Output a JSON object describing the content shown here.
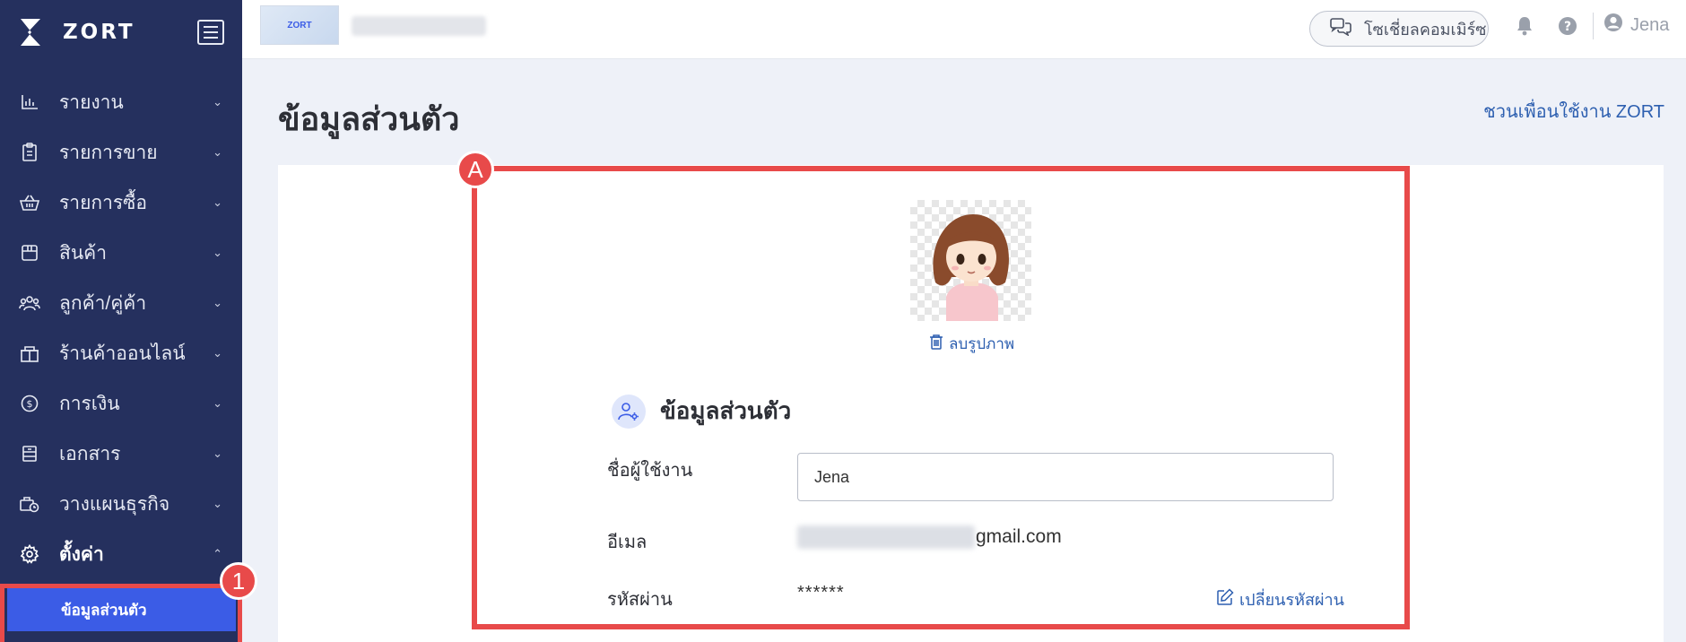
{
  "brand": {
    "name": "ZORT"
  },
  "sidebar": {
    "items": [
      {
        "label": "รายงาน",
        "icon": "chart-icon"
      },
      {
        "label": "รายการขาย",
        "icon": "clipboard-icon"
      },
      {
        "label": "รายการซื้อ",
        "icon": "basket-icon"
      },
      {
        "label": "สินค้า",
        "icon": "box-icon"
      },
      {
        "label": "ลูกค้า/คู่ค้า",
        "icon": "users-icon"
      },
      {
        "label": "ร้านค้าออนไลน์",
        "icon": "store-icon"
      },
      {
        "label": "การเงิน",
        "icon": "dollar-icon"
      },
      {
        "label": "เอกสาร",
        "icon": "document-icon"
      },
      {
        "label": "วางแผนธุรกิจ",
        "icon": "business-plan-icon"
      },
      {
        "label": "ตั้งค่า",
        "icon": "gear-icon",
        "expanded": true
      }
    ],
    "sub_item": "ข้อมูลส่วนตัว"
  },
  "topbar": {
    "shop_thumb_text": "ZORT",
    "social_commerce": "โซเชี่ยลคอมเมิร์ซ",
    "user_name": "Jena"
  },
  "page": {
    "title": "ข้อมูลส่วนตัว",
    "invite_link": "ชวนเพื่อนใช้งาน ZORT"
  },
  "profile": {
    "delete_photo": "ลบรูปภาพ",
    "section_title": "ข้อมูลส่วนตัว",
    "username_label": "ชื่อผู้ใช้งาน",
    "username_value": "Jena",
    "email_label": "อีเมล",
    "email_suffix": "gmail.com",
    "password_label": "รหัสผ่าน",
    "password_value": "******",
    "change_password": "เปลี่ยนรหัสผ่าน"
  },
  "annotations": {
    "sidebar_badge": "1",
    "card_badge": "A"
  },
  "colors": {
    "sidebar_bg": "#25305e",
    "accent": "#3b5ce6",
    "highlight": "#e84a4a",
    "link": "#2d5fb0"
  }
}
